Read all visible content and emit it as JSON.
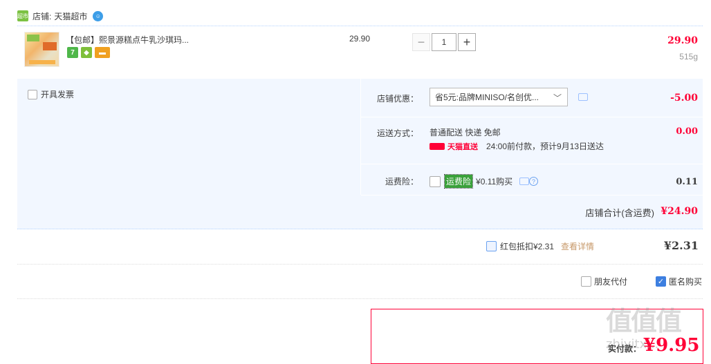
{
  "shop": {
    "icon_text": "超市",
    "label": "店铺:",
    "name": "天猫超市"
  },
  "item": {
    "title": "【包邮】熙景源糕点牛乳沙琪玛...",
    "unit_price": "29.90",
    "quantity": "1",
    "subtotal": "29.90",
    "weight": "515g"
  },
  "invoice": {
    "label": "开具发票"
  },
  "discount": {
    "label": "店铺优惠：",
    "selected": "省5元:品牌MINISO/名创优...",
    "value": "-5.00"
  },
  "shipping": {
    "label": "运送方式：",
    "method": "普通配送 快递 免邮",
    "badge": "天猫直送",
    "eta": "24:00前付款，预计9月13日送达",
    "value": "0.00"
  },
  "insurance": {
    "label": "运费险：",
    "tag": "运费险",
    "price": "¥0.11购买",
    "value": "0.11"
  },
  "store_total": {
    "label": "店铺合计(含运费)",
    "value": "¥24.90"
  },
  "redpacket": {
    "label": "红包抵扣¥2.31",
    "link": "查看详情",
    "value": "¥2.31"
  },
  "options": {
    "friend_pay": "朋友代付",
    "anonymous": "匿名购买"
  },
  "payment": {
    "label": "实付款：",
    "amount": "¥9.95"
  },
  "watermark": {
    "main": "值值值",
    "sub": "zhiyitx..."
  },
  "colors": {
    "accent": "#ff0036",
    "panel": "#f2f7ff",
    "link": "#c7996a"
  }
}
